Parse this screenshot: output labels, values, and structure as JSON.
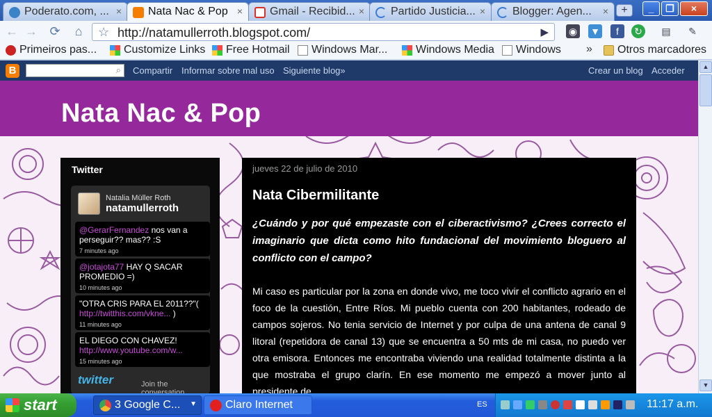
{
  "browser": {
    "tabs": [
      {
        "label": "Poderato.com, ...",
        "icon_color": "#3b83c7"
      },
      {
        "label": "Nata Nac & Pop",
        "icon_color": "#f57d00",
        "active": true
      },
      {
        "label": "Gmail - Recibid...",
        "icon_color": "#d93025"
      },
      {
        "label": "Partido Justicia...",
        "icon_color": "#3a7bd5"
      },
      {
        "label": "Blogger: Agen...",
        "icon_color": "#3a7bd5"
      }
    ],
    "new_tab_label": "+",
    "close_glyph": "×",
    "window_buttons": {
      "minimize": "_",
      "maximize": "❐",
      "close": "×"
    },
    "address_url": "http://natamullerroth.blogspot.com/",
    "bookmarks": [
      {
        "label": "Primeiros pas...",
        "icon": "red-cross-icon"
      },
      {
        "label": "Customize Links",
        "icon": "windows-flag-icon"
      },
      {
        "label": "Free Hotmail",
        "icon": "windows-flag-icon"
      },
      {
        "label": "Windows Mar...",
        "icon": "page-icon"
      },
      {
        "label": "Windows Media",
        "icon": "windows-flag-icon"
      },
      {
        "label": "Windows",
        "icon": "page-icon"
      }
    ],
    "bookmarks_overflow": "»",
    "other_bookmarks": "Otros marcadores"
  },
  "blogger_bar": {
    "links": [
      "Compartir",
      "Informar sobre mal uso",
      "Siguiente blog»"
    ],
    "right_links": [
      "Crear un blog",
      "Acceder"
    ]
  },
  "blog": {
    "title": "Nata Nac & Pop",
    "header_color": "#95289b"
  },
  "twitter": {
    "heading": "Twitter",
    "name": "Natalia Müller Roth",
    "handle": "natamullerroth",
    "tweets": [
      {
        "mention": "@GerarFernandez",
        "text": " nos van a perseguir?? mas?? :S",
        "time": "7 minutes ago"
      },
      {
        "mention": "@jotajota77",
        "text": " HAY Q SACAR PROMEDIO =)",
        "time": "10 minutes ago"
      },
      {
        "text": "\"OTRA CRIS PARA EL 2011??\"( ",
        "link": "http://twitthis.com/vkne...",
        "tail": " )",
        "time": "11 minutes ago"
      },
      {
        "text": "EL DIEGO CON CHAVEZ! ",
        "link": "http://www.youtube.com/w...",
        "time": "15 minutes ago"
      }
    ],
    "logo_text": "twitter",
    "join_text": "Join the conversation"
  },
  "post": {
    "date": "jueves 22 de julio de 2010",
    "title": "Nata Cibermilitante",
    "question": "¿Cuándo y por qué empezaste con el ciberactivismo? ¿Crees correcto el imaginario que dicta como hito fundacional del movimiento bloguero al conflicto con el campo?",
    "body": "Mi caso es particular por la zona en donde vivo, me toco vivir el conflicto agrario en el foco de la cuestión, Entre Ríos. Mi pueblo cuenta con 200 habitantes, rodeado de campos sojeros. No tenia servicio de Internet y por culpa de una antena de canal 9 litoral (repetidora de canal 13) que se encuentra a 50 mts de mi casa, no puedo ver otra emisora. Entonces me encontraba viviendo una realidad totalmente distinta a la que mostraba el grupo clarín. En ese momento me empezó a mover junto al presidente de"
  },
  "taskbar": {
    "start_label": "start",
    "tasks": [
      {
        "label": "3 Google C...",
        "icon_color": "#e8453c"
      },
      {
        "label": "Claro Internet",
        "icon_color": "#e32020"
      }
    ],
    "language": "ES",
    "clock": "11:17 a.m."
  }
}
